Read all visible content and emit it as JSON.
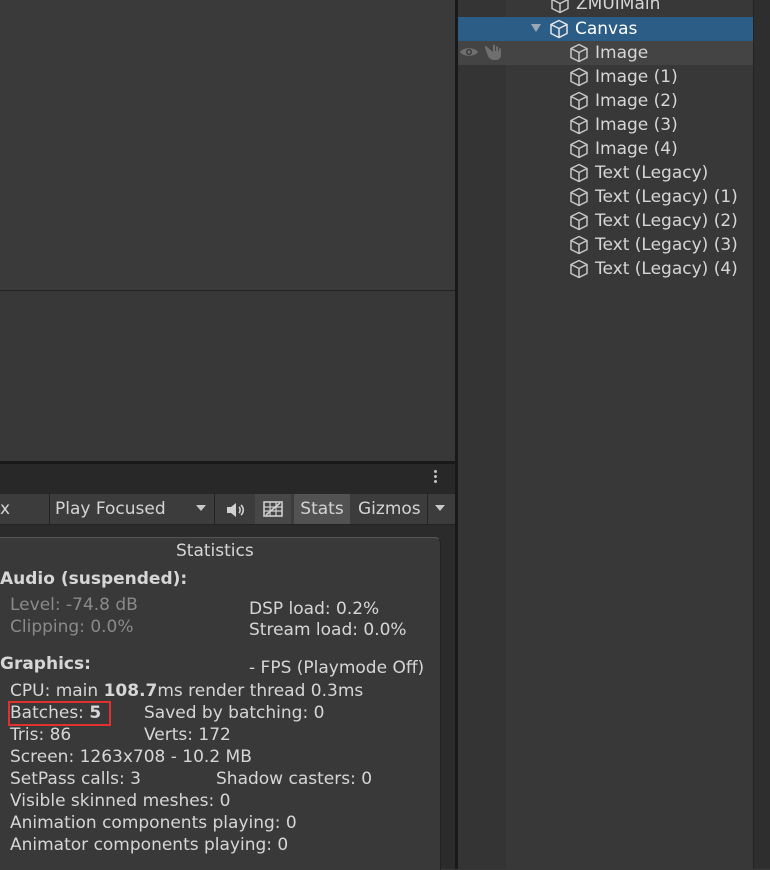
{
  "hierarchy": {
    "parent_label": "ZMUIMain",
    "canvas_label": "Canvas",
    "children": [
      "Image",
      "Image (1)",
      "Image (2)",
      "Image (3)",
      "Image (4)",
      "Text (Legacy)",
      "Text (Legacy) (1)",
      "Text (Legacy) (2)",
      "Text (Legacy) (3)",
      "Text (Legacy) (4)"
    ],
    "selected_color": "#2c5d87"
  },
  "toolbar": {
    "partial_label": "x",
    "play_mode": "Play Focused",
    "stats_label": "Stats",
    "gizmos_label": "Gizmos"
  },
  "stats": {
    "title": "Statistics",
    "audio_header": "Audio (suspended):",
    "level": "Level: -74.8 dB",
    "clipping": "Clipping: 0.0%",
    "dsp_load": "DSP load: 0.2%",
    "stream_load": "Stream load: 0.0%",
    "graphics_header": "Graphics:",
    "fps": "- FPS (Playmode Off)",
    "cpu_prefix": "CPU: main ",
    "cpu_main_value": "108.7",
    "cpu_suffix": "ms  render thread 0.3ms",
    "batches_label": "Batches: ",
    "batches_value": "5",
    "saved_by_batching": "Saved by batching: 0",
    "tris": "Tris: 86",
    "verts": "Verts: 172",
    "screen": "Screen: 1263x708 - 10.2 MB",
    "setpass": "SetPass calls: 3",
    "shadow_casters": "Shadow casters: 0",
    "skinned_meshes": "Visible skinned meshes: 0",
    "animation_components": "Animation components playing: 0",
    "animator_components": "Animator components playing: 0",
    "highlight_color": "#e03030"
  }
}
